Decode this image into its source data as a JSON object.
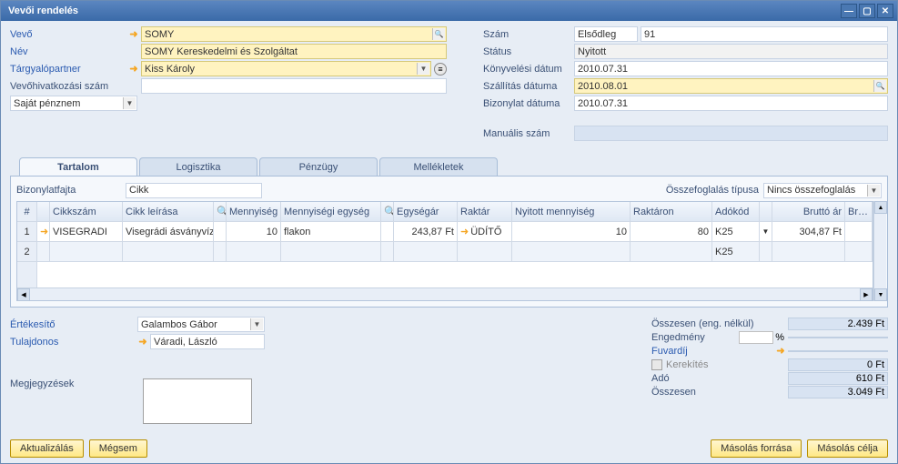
{
  "title": "Vevői rendelés",
  "header": {
    "left": {
      "vendor_label": "Vevő",
      "vendor": "SOMY",
      "name_label": "Név",
      "name": "SOMY Kereskedelmi és Szolgáltat",
      "contact_label": "Tárgyalópartner",
      "contact": "Kiss Károly",
      "ref_label": "Vevőhivatkozási szám",
      "ref": "",
      "currency": "Saját pénznem"
    },
    "right": {
      "num_label": "Szám",
      "num_series": "Elsődleg",
      "num": "91",
      "status_label": "Státus",
      "status": "Nyitott",
      "posting_label": "Könyvelési dátum",
      "posting": "2010.07.31",
      "ship_label": "Szállítás dátuma",
      "ship": "2010.08.01",
      "doc_label": "Bizonylat dátuma",
      "doc": "2010.07.31",
      "manual_label": "Manuális szám",
      "manual": ""
    }
  },
  "tabs": [
    "Tartalom",
    "Logisztika",
    "Pénzügy",
    "Mellékletek"
  ],
  "doc_type_label": "Bizonylatfajta",
  "doc_type": "Cikk",
  "summary_label": "Összefoglalás típusa",
  "summary": "Nincs összefoglalás",
  "grid": {
    "columns": [
      "#",
      "Cikkszám",
      "Cikk leírása",
      "Mennyiség",
      "Mennyiségi egység",
      "Egységár",
      "Raktár",
      "Nyitott mennyiség",
      "Raktáron",
      "Adókód",
      "Bruttó ár",
      "Br…"
    ],
    "rows": [
      {
        "num": "1",
        "code": "VISEGRADI",
        "desc": "Visegrádi ásványvíz",
        "qty": "10",
        "uom": "flakon",
        "price": "243,87 Ft",
        "whs": "ÜDÍTŐ",
        "openqty": "10",
        "instock": "80",
        "tax": "K25",
        "gross": "304,87 Ft"
      },
      {
        "num": "2",
        "code": "",
        "desc": "",
        "qty": "",
        "uom": "",
        "price": "",
        "whs": "",
        "openqty": "",
        "instock": "",
        "tax": "K25",
        "gross": ""
      }
    ]
  },
  "below": {
    "sales_label": "Értékesítő",
    "sales": "Galambos Gábor",
    "owner_label": "Tulajdonos",
    "owner": "Váradi, László",
    "remarks_label": "Megjegyzések",
    "remarks": ""
  },
  "totals": {
    "subtotal_label": "Összesen (eng. nélkül)",
    "subtotal": "2.439 Ft",
    "discount_label": "Engedmény",
    "discount_pct": "",
    "discount_val": "",
    "pct_sign": "%",
    "freight_label": "Fuvardíj",
    "freight": "",
    "round_label": "Kerekítés",
    "round": "0 Ft",
    "tax_label": "Adó",
    "tax": "610 Ft",
    "total_label": "Összesen",
    "total": "3.049 Ft"
  },
  "buttons": {
    "update": "Aktualizálás",
    "cancel": "Mégsem",
    "copy_from": "Másolás forrása",
    "copy_to": "Másolás célja"
  }
}
